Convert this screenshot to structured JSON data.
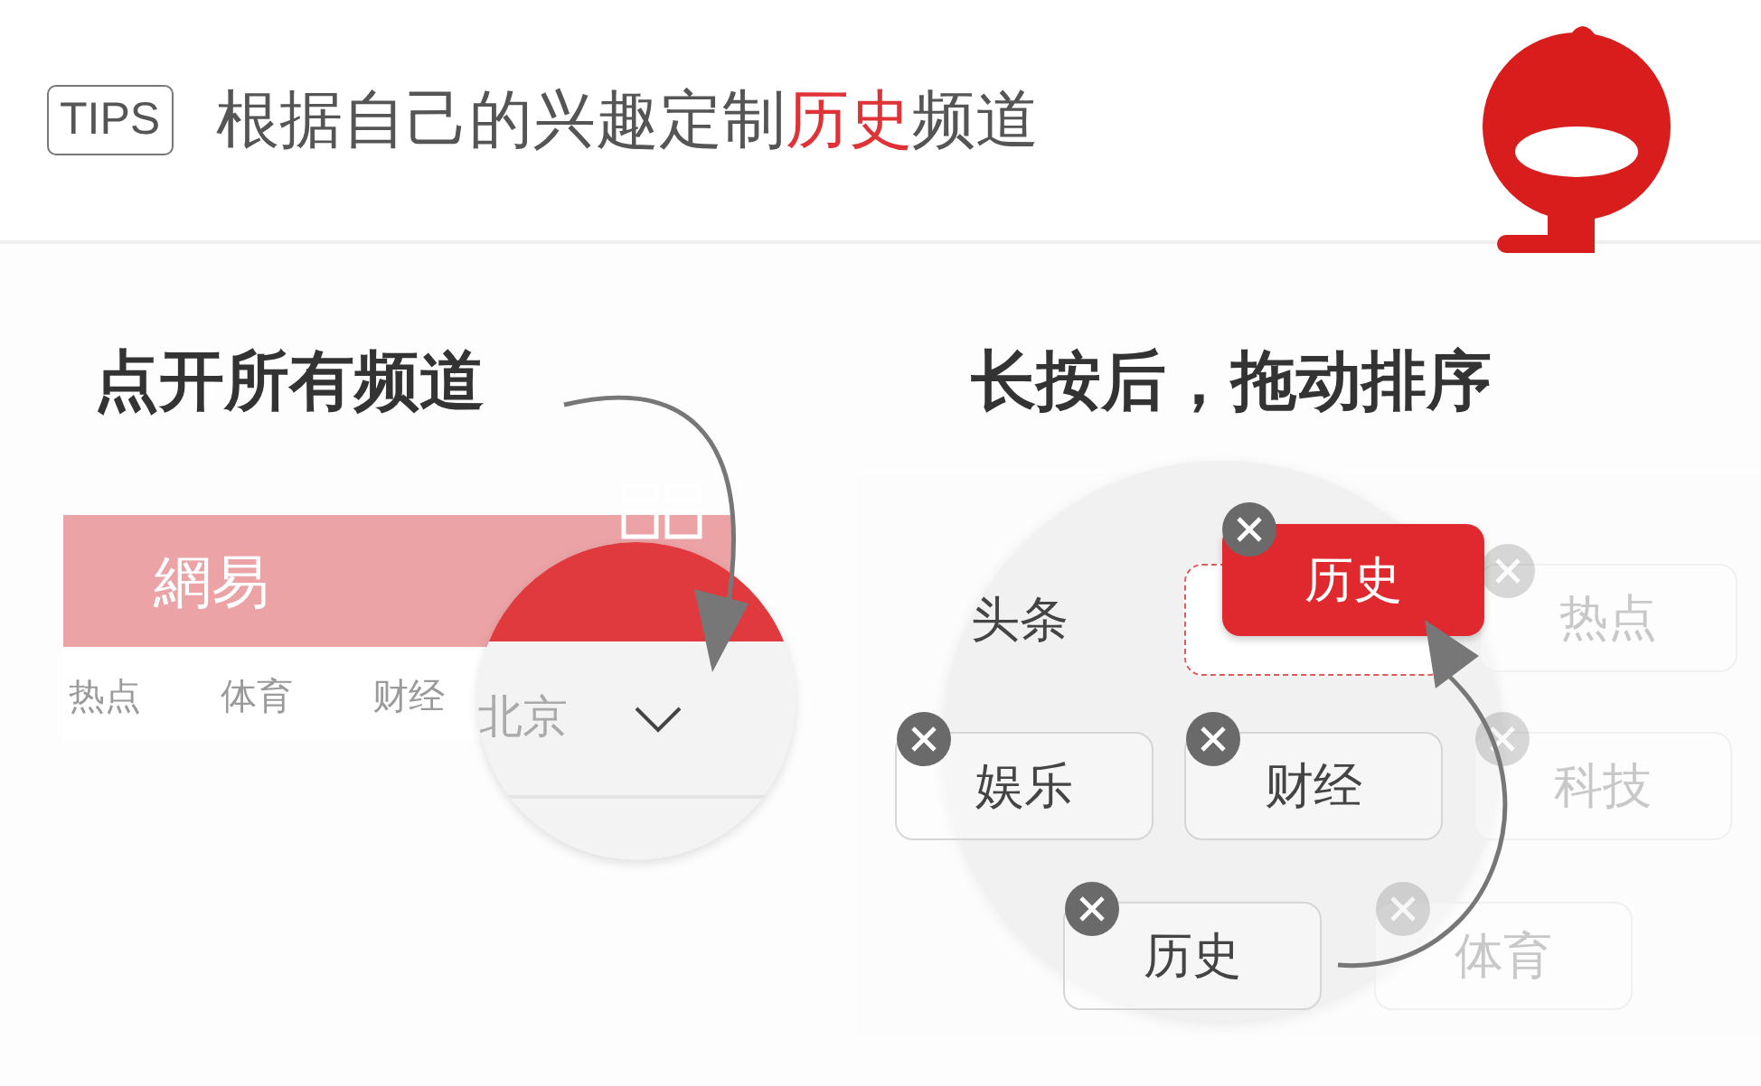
{
  "header": {
    "badge": "TIPS",
    "title_parts": [
      {
        "text": "根据自己的兴趣定制",
        "highlight": false
      },
      {
        "text": "历史",
        "highlight": true
      },
      {
        "text": "频道",
        "highlight": false
      }
    ]
  },
  "left": {
    "heading": "点开所有频道",
    "app_logo": "網易",
    "tabs": [
      "热点",
      "体育",
      "财经"
    ],
    "magnified_tab": "北京"
  },
  "right": {
    "heading": "长按后，拖动排序",
    "fixed_channel": "头条",
    "dragging": "历史",
    "channels": [
      {
        "label": "热点",
        "faded": true
      },
      {
        "label": "娱乐",
        "faded": false
      },
      {
        "label": "财经",
        "faded": false
      },
      {
        "label": "科技",
        "faded": true
      },
      {
        "label": "历史",
        "faded": false
      },
      {
        "label": "体育",
        "faded": true
      }
    ]
  }
}
